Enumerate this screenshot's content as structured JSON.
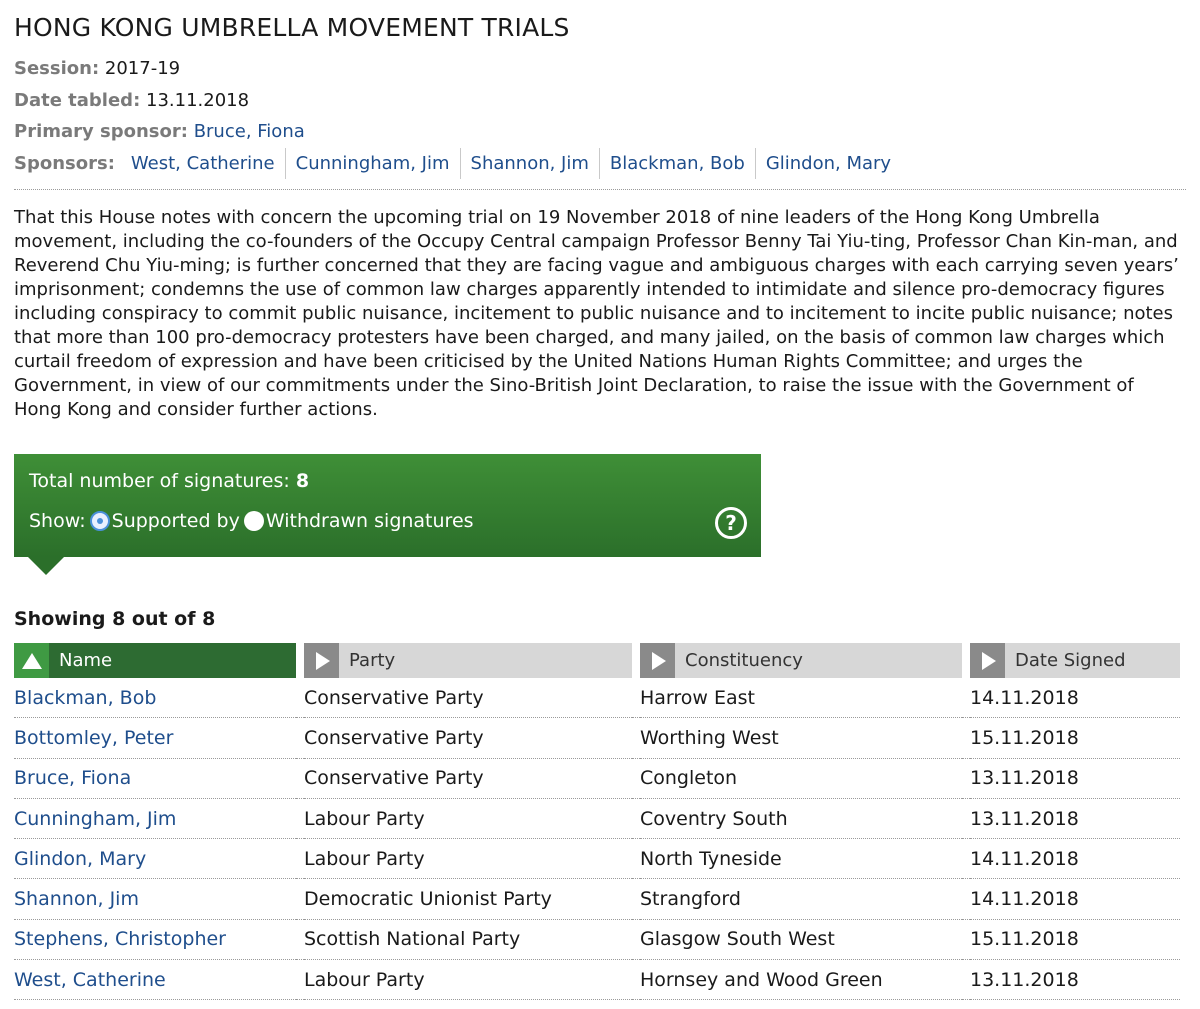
{
  "title": "HONG KONG UMBRELLA MOVEMENT TRIALS",
  "meta": {
    "session_label": "Session:",
    "session_value": "2017-19",
    "date_label": "Date tabled:",
    "date_value": "13.11.2018",
    "sponsor_label": "Primary sponsor:",
    "sponsor_value": "Bruce, Fiona",
    "sponsors_label": "Sponsors:",
    "sponsors": [
      "West, Catherine",
      "Cunningham, Jim",
      "Shannon, Jim",
      "Blackman, Bob",
      "Glindon, Mary"
    ]
  },
  "motion_text": "That this House notes with concern the upcoming trial on 19 November 2018 of nine leaders of the Hong Kong Umbrella movement, including the co-founders of the Occupy Central campaign Professor Benny Tai Yiu-ting, Professor Chan Kin-man, and Reverend Chu Yiu-ming; is further concerned that they are facing vague and ambiguous charges with each carrying seven years’ imprisonment; condemns the use of common law charges apparently intended to intimidate and silence pro-democracy figures including conspiracy to commit public nuisance, incitement to public nuisance and to incitement to incite public nuisance; notes that more than 100 pro-democracy protesters have been charged, and many jailed, on the basis of common law charges which curtail freedom of expression and have been criticised by the United Nations Human Rights Committee; and urges the Government, in view of our commitments under the Sino-British Joint Declaration, to raise the issue with the Government of Hong Kong and consider further actions.",
  "signatures": {
    "total_label": "Total number of signatures:",
    "total_value": "8",
    "show_label": "Show:",
    "option_supported": "Supported by",
    "option_withdrawn": "Withdrawn signatures",
    "selected": "Supported by",
    "help_glyph": "?"
  },
  "showing_text": "Showing 8 out of 8",
  "table": {
    "headers": [
      "Name",
      "Party",
      "Constituency",
      "Date Signed"
    ],
    "sorted_column": "Name",
    "rows": [
      [
        "Blackman, Bob",
        "Conservative Party",
        "Harrow East",
        "14.11.2018"
      ],
      [
        "Bottomley, Peter",
        "Conservative Party",
        "Worthing West",
        "15.11.2018"
      ],
      [
        "Bruce, Fiona",
        "Conservative Party",
        "Congleton",
        "13.11.2018"
      ],
      [
        "Cunningham, Jim",
        "Labour Party",
        "Coventry South",
        "13.11.2018"
      ],
      [
        "Glindon, Mary",
        "Labour Party",
        "North Tyneside",
        "14.11.2018"
      ],
      [
        "Shannon, Jim",
        "Democratic Unionist Party",
        "Strangford",
        "14.11.2018"
      ],
      [
        "Stephens, Christopher",
        "Scottish National Party",
        "Glasgow South West",
        "15.11.2018"
      ],
      [
        "West, Catherine",
        "Labour Party",
        "Hornsey and Wood Green",
        "13.11.2018"
      ]
    ]
  },
  "colors": {
    "link": "#1f4e8c",
    "green_box": "#2b6f2a",
    "active_header": "#2d6b32",
    "inactive_header": "#d7d7d7"
  }
}
